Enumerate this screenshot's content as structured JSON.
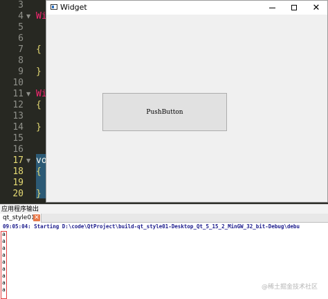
{
  "editor": {
    "line_numbers": [
      "3",
      "4",
      "5",
      "6",
      "7",
      "8",
      "9",
      "10",
      "11",
      "12",
      "13",
      "14",
      "15",
      "16",
      "17",
      "18",
      "19",
      "20"
    ],
    "current_line": "17",
    "visible_code_fragments": [
      "Wi",
      "{",
      "}",
      "Wi",
      "{",
      "}",
      "vo",
      "{",
      "}"
    ]
  },
  "window": {
    "title": "Widget",
    "minimize_label": "Minimize",
    "maximize_label": "Maximize",
    "close_label": "Close",
    "push_button_label": "PushButton"
  },
  "output_pane": {
    "title": "应用程序输出",
    "tab_label": "qt_style01",
    "tab_close_glyph": "✕",
    "start_line": "09:05:04: Starting D:\\code\\QtProject\\build-qt_style01-Desktop_Qt_5_15_2_MinGW_32_bit-Debug\\debu",
    "lines": [
      "a",
      "a",
      "a",
      "a",
      "a",
      "a",
      "a",
      "a",
      "a"
    ]
  },
  "watermark": "@稀土掘金技术社区",
  "colors": {
    "editor_bg": "#272822",
    "keyword": "#f92672",
    "output_text": "#1a1a8c",
    "selection_border": "#e23c3c",
    "tab_close": "#e8794a"
  }
}
